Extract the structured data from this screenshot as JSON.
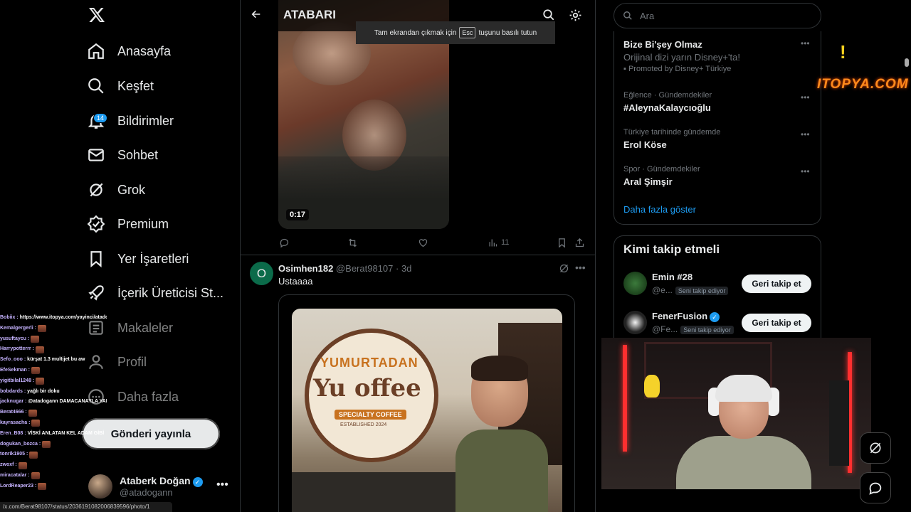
{
  "nav": {
    "items": [
      {
        "label": "Anasayfa",
        "icon": "home-icon"
      },
      {
        "label": "Keşfet",
        "icon": "search-icon"
      },
      {
        "label": "Bildirimler",
        "icon": "bell-icon",
        "badge": "14"
      },
      {
        "label": "Sohbet",
        "icon": "mail-icon"
      },
      {
        "label": "Grok",
        "icon": "grok-icon"
      },
      {
        "label": "Premium",
        "icon": "premium-icon"
      },
      {
        "label": "Yer İşaretleri",
        "icon": "bookmark-icon"
      },
      {
        "label": "İçerik Üreticisi St...",
        "icon": "rocket-icon"
      },
      {
        "label": "Makaleler",
        "icon": "article-icon"
      },
      {
        "label": "Profil",
        "icon": "user-icon"
      },
      {
        "label": "Daha fazla",
        "icon": "more-circle-icon"
      }
    ],
    "post_button": "Gönderi yayınla",
    "account": {
      "name": "Ataberk Doğan",
      "handle": "@atadogann"
    }
  },
  "header": {
    "title": "ATABARI",
    "fullscreen_toast_prefix": "Tam ekrandan çıkmak için",
    "fullscreen_toast_key": "Esc",
    "fullscreen_toast_suffix": "tuşunu basılı tutun"
  },
  "video_post": {
    "duration": "0:17",
    "views": "11"
  },
  "post": {
    "avatar_letter": "O",
    "name": "Osimhen182",
    "handle": "@Berat98107",
    "time": "3d",
    "text": "Ustaaaa",
    "image_logo_top": "YUMURTADAN",
    "image_logo_main": "Yu  offee",
    "image_logo_sub": "SPECIALTY COFFEE",
    "image_logo_est": "ESTABLISHED 2024"
  },
  "search": {
    "placeholder": "Ara"
  },
  "trends": [
    {
      "title": "Bize Bi'şey Olmaz",
      "sub": "Orijinal dizi yarın Disney+'ta!",
      "promo": "Promoted by Disney+ Türkiye"
    },
    {
      "category": "Eğlence · Gündemdekiler",
      "title": "#AleynaKalaycıoğlu"
    },
    {
      "category": "Türkiye tarihinde gündemde",
      "title": "Erol Köse"
    },
    {
      "category": "Spor · Gündemdekiler",
      "title": "Aral Şimşir"
    }
  ],
  "show_more": "Daha fazla göster",
  "who_to_follow": {
    "title": "Kimi takip etmeli",
    "users": [
      {
        "name": "Emin #28",
        "handle": "@e...",
        "tag": "Seni takip ediyor",
        "button": "Geri takip et"
      },
      {
        "name": "FenerFusion",
        "handle": "@Fe...",
        "tag": "Seni takip ediyor",
        "button": "Geri takip et"
      }
    ]
  },
  "chat": [
    {
      "user": "Bobiix",
      "msg": "https://www.itopya.com/yayinci/atadogann/bagis-yap"
    },
    {
      "user": "Kemalgergerli",
      "msg": ""
    },
    {
      "user": "yusuftaycu",
      "msg": ""
    },
    {
      "user": "Harrypotterrr",
      "msg": ""
    },
    {
      "user": "Sefo_ooo",
      "msg": "kürşat 1.3 multijet bu aw"
    },
    {
      "user": "EfeSekman",
      "msg": ""
    },
    {
      "user": "yigitbilal1248",
      "msg": ""
    },
    {
      "user": "bobdards",
      "msg": "yağlı bir doku"
    },
    {
      "user": "jacknugar",
      "msg": "@atadogann DAMACANAYLA YAPSAYMIŞ AMK"
    },
    {
      "user": "Berat4666",
      "msg": ""
    },
    {
      "user": "kayrasacha",
      "msg": ""
    },
    {
      "user": "Eren_B08",
      "msg": "VİSKİ ANLATAN KEL ADAM GİBİ"
    },
    {
      "user": "dogukan_bozca",
      "msg": ""
    },
    {
      "user": "tonrik1905",
      "msg": ""
    },
    {
      "user": "zwoxf",
      "msg": ""
    },
    {
      "user": "miracatalar",
      "msg": ""
    },
    {
      "user": "LordReaper23",
      "msg": ""
    }
  ],
  "status_url": "/x.com/Berat98107/status/2036191082006839596/photo/1",
  "overlay": {
    "brand": "ITOPYA.COM",
    "alert": "!"
  },
  "colors": {
    "accent": "#1d9bf0",
    "background": "#000000",
    "text": "#e7e9ea",
    "muted": "#71767b"
  }
}
